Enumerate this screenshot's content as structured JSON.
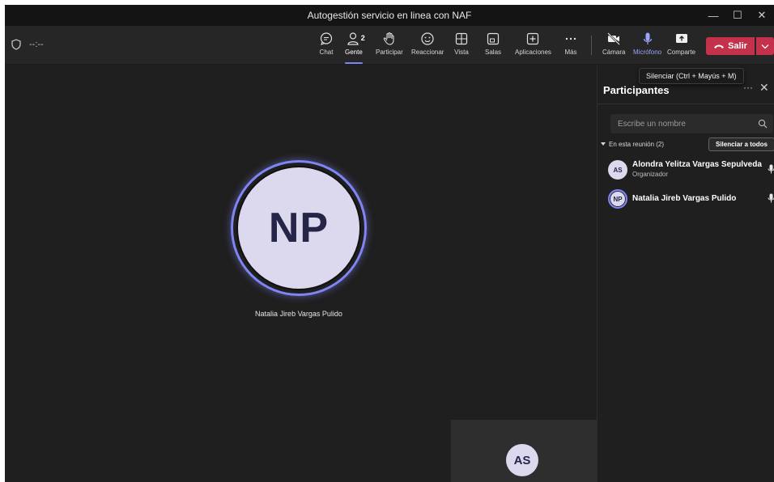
{
  "window": {
    "title": "Autogestión servicio en linea con NAF",
    "minimize": "—",
    "maximize": "☐",
    "close": "✕"
  },
  "toolbar": {
    "timer": "--:--",
    "chat": "Chat",
    "people": "Gente",
    "people_count": "2",
    "raise": "Participar",
    "react": "Reaccionar",
    "view": "Vista",
    "rooms": "Salas",
    "apps": "Aplicaciones",
    "more": "Más",
    "camera": "Cámara",
    "mic": "Micrófono",
    "share": "Comparte",
    "leave": "Salir"
  },
  "tooltip": {
    "text": "Silenciar (Ctrl + Mayús + M)"
  },
  "stage": {
    "speaker_initials": "NP",
    "speaker_name": "Natalia Jireb Vargas Pulido",
    "self_initials": "AS"
  },
  "panel": {
    "title": "Participantes",
    "search_placeholder": "Escribe un nombre",
    "section_label": "En esta reunión (2)",
    "mute_all": "Silenciar a todos",
    "participants": [
      {
        "initials": "AS",
        "name": "Alondra Yelitza Vargas Sepulveda",
        "role": "Organizador"
      },
      {
        "initials": "NP",
        "name": "Natalia Jireb Vargas Pulido",
        "role": ""
      }
    ]
  },
  "colors": {
    "accent": "#7f85f5",
    "leave": "#c4314b",
    "background": "#1f1f1f",
    "avatar": "#dcd9ef"
  }
}
